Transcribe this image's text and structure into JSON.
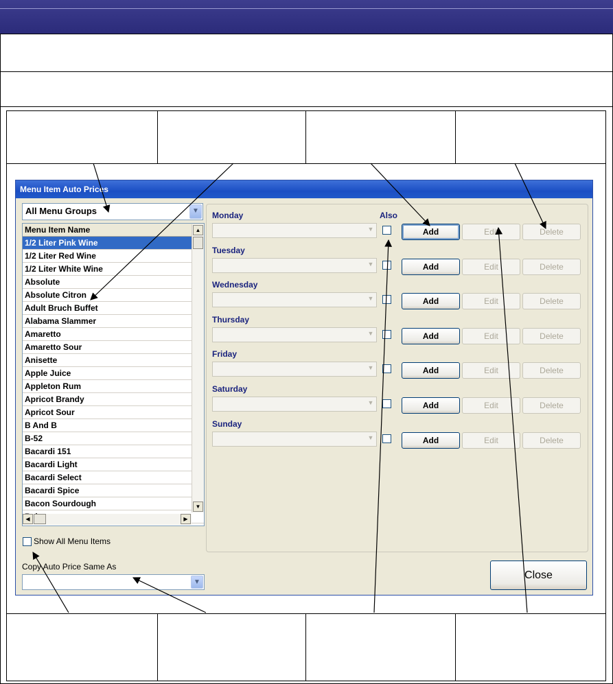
{
  "dialog": {
    "title": "Menu Item Auto Prices",
    "group_filter": {
      "value": "All Menu Groups"
    },
    "list": {
      "header": "Menu Item Name",
      "items": [
        "1/2 Liter Pink Wine",
        "1/2 Liter Red Wine",
        "1/2 Liter White Wine",
        "Absolute",
        "Absolute Citron",
        "Adult Bruch Buffet",
        "Alabama Slammer",
        "Amaretto",
        "Amaretto Sour",
        "Anisette",
        "Apple Juice",
        "Appleton Rum",
        "Apricot Brandy",
        "Apricot Sour",
        "B And B",
        "B-52",
        "Bacardi 151",
        "Bacardi Light",
        "Bacardi Select",
        "Bacardi Spice",
        "Bacon Sourdough",
        "Bal..."
      ],
      "selected_index": 0
    },
    "show_all_label": "Show All Menu Items",
    "copy_label": "Copy Auto Price Same As",
    "copy_value": "",
    "also_label": "Also",
    "days": [
      "Monday",
      "Tuesday",
      "Wednesday",
      "Thursday",
      "Friday",
      "Saturday",
      "Sunday"
    ],
    "buttons": {
      "add": "Add",
      "edit": "Edit",
      "delete": "Delete"
    },
    "close_label": "Close"
  }
}
